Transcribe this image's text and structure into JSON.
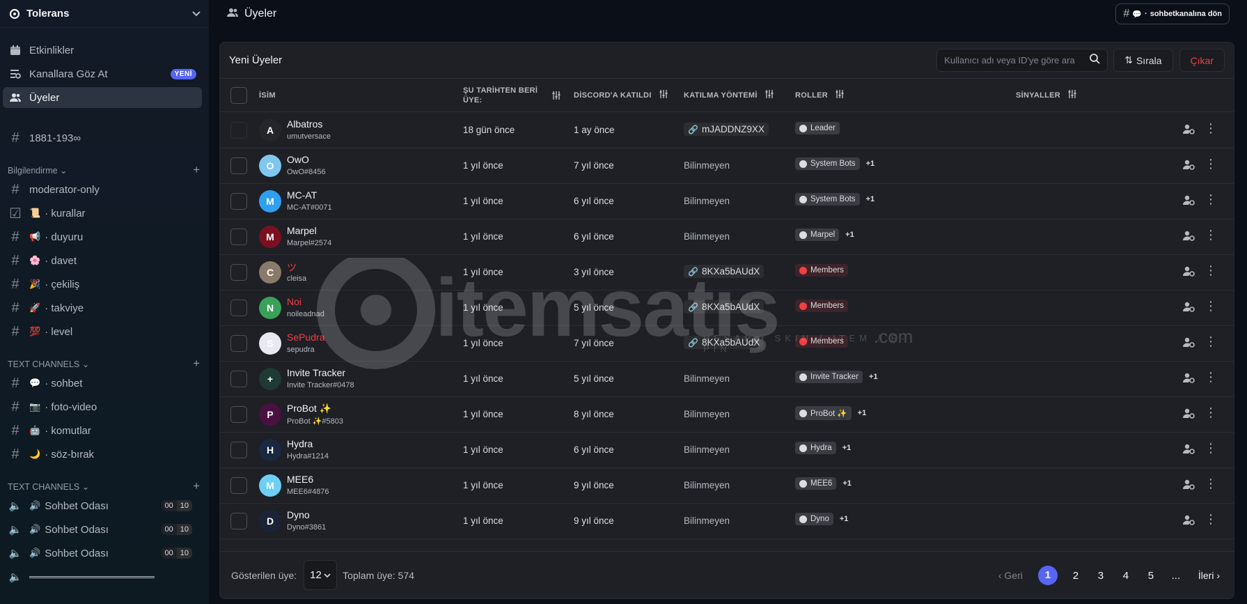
{
  "server": {
    "name": "Tolerans"
  },
  "nav": [
    {
      "label": "Etkinlikler",
      "icon": "calendar-icon"
    },
    {
      "label": "Kanallara Göz At",
      "icon": "browse-channels-icon",
      "badge": "YENİ"
    },
    {
      "label": "Üyeler",
      "icon": "members-icon",
      "active": true
    }
  ],
  "pinned_channel": {
    "label": "1881-193∞"
  },
  "categories": [
    {
      "label": "Bilgilendirme",
      "channels": [
        {
          "label": "moderator-only",
          "emoji": ""
        },
        {
          "label": "kurallar",
          "emoji": "📜"
        },
        {
          "label": "duyuru",
          "emoji": "📢"
        },
        {
          "label": "davet",
          "emoji": "🌸"
        },
        {
          "label": "çekiliş",
          "emoji": "🎉"
        },
        {
          "label": "takviye",
          "emoji": "🚀"
        },
        {
          "label": "level",
          "emoji": "💯"
        }
      ]
    },
    {
      "label": "TEXT CHANNELS",
      "channels": [
        {
          "label": "sohbet",
          "emoji": "💬"
        },
        {
          "label": "foto-video",
          "emoji": "📷"
        },
        {
          "label": "komutlar",
          "emoji": "🤖"
        },
        {
          "label": "söz-bırak",
          "emoji": "🌙"
        }
      ]
    },
    {
      "label": "TEXT CHANNELS",
      "voice": [
        {
          "label": "Sohbet Odası",
          "emoji": "🔊",
          "count_a": "00",
          "count_b": "10"
        },
        {
          "label": "Sohbet Odası",
          "emoji": "🔊",
          "count_a": "00",
          "count_b": "10"
        },
        {
          "label": "Sohbet Odası",
          "emoji": "🔊",
          "count_a": "00",
          "count_b": "10"
        }
      ]
    }
  ],
  "topbar": {
    "title": "Üyeler",
    "back_label": "sohbetkanalına dön"
  },
  "panel": {
    "title": "Yeni Üyeler",
    "search_placeholder": "Kullanıcı adı veya ID'ye göre ara",
    "sort_label": "Sırala",
    "kick_label": "Çıkar",
    "columns": {
      "name": "İSİM",
      "since_1": "ŞU TARİHTEN BERİ",
      "since_2": "ÜYE:",
      "discord": "DİSCORD'A KATILDI",
      "method": "KATILMA YÖNTEMİ",
      "roles": "ROLLER",
      "signals": "SİNYALLER"
    },
    "members": [
      {
        "name": "Albatros",
        "tag": "umutversace",
        "since": "18 gün önce",
        "discord": "1 ay önce",
        "method": "mJADDNZ9XX",
        "method_link": true,
        "role": "Leader",
        "role_extra": "",
        "avatar_color": "#23272a",
        "avatar_letter": "A",
        "red_name": false,
        "red_role": false
      },
      {
        "name": "OwO",
        "tag": "OwO#8456",
        "since": "1 yıl önce",
        "discord": "7 yıl önce",
        "method": "Bilinmeyen",
        "method_link": false,
        "role": "System Bots",
        "role_extra": "+1",
        "avatar_color": "#7ec8f0",
        "avatar_letter": "O",
        "red_name": false,
        "red_role": false
      },
      {
        "name": "MC-AT",
        "tag": "MC-AT#0071",
        "since": "1 yıl önce",
        "discord": "6 yıl önce",
        "method": "Bilinmeyen",
        "method_link": false,
        "role": "System Bots",
        "role_extra": "+1",
        "avatar_color": "#2f9ff0",
        "avatar_letter": "M",
        "red_name": false,
        "red_role": false
      },
      {
        "name": "Marpel",
        "tag": "Marpel#2574",
        "since": "1 yıl önce",
        "discord": "6 yıl önce",
        "method": "Bilinmeyen",
        "method_link": false,
        "role": "Marpel",
        "role_extra": "+1",
        "avatar_color": "#7a1020",
        "avatar_letter": "M",
        "red_name": false,
        "red_role": false
      },
      {
        "name": "ツ",
        "tag": "cleisa",
        "since": "1 yıl önce",
        "discord": "3 yıl önce",
        "method": "8KXa5bAUdX",
        "method_link": true,
        "role": "Members",
        "role_extra": "",
        "avatar_color": "#8a7a6a",
        "avatar_letter": "C",
        "red_name": true,
        "red_role": true
      },
      {
        "name": "Noi",
        "tag": "noileadnad",
        "since": "1 yıl önce",
        "discord": "5 yıl önce",
        "method": "8KXa5bAUdX",
        "method_link": true,
        "role": "Members",
        "role_extra": "",
        "avatar_color": "#3aa05a",
        "avatar_letter": "N",
        "red_name": true,
        "red_role": true
      },
      {
        "name": "SePudra",
        "tag": "sepudra",
        "since": "1 yıl önce",
        "discord": "7 yıl önce",
        "method": "8KXa5bAUdX",
        "method_link": true,
        "role": "Members",
        "role_extra": "",
        "avatar_color": "#e8e8f0",
        "avatar_letter": "S",
        "red_name": true,
        "red_role": true
      },
      {
        "name": "Invite Tracker",
        "tag": "Invite Tracker#0478",
        "since": "1 yıl önce",
        "discord": "5 yıl önce",
        "method": "Bilinmeyen",
        "method_link": false,
        "role": "Invite Tracker",
        "role_extra": "+1",
        "avatar_color": "#1e3a34",
        "avatar_letter": "+",
        "red_name": false,
        "red_role": false
      },
      {
        "name": "ProBot ✨",
        "tag": "ProBot ✨#5803",
        "since": "1 yıl önce",
        "discord": "8 yıl önce",
        "method": "Bilinmeyen",
        "method_link": false,
        "role": "ProBot ✨",
        "role_extra": "+1",
        "avatar_color": "#4a1040",
        "avatar_letter": "P",
        "red_name": false,
        "red_role": false
      },
      {
        "name": "Hydra",
        "tag": "Hydra#1214",
        "since": "1 yıl önce",
        "discord": "6 yıl önce",
        "method": "Bilinmeyen",
        "method_link": false,
        "role": "Hydra",
        "role_extra": "+1",
        "avatar_color": "#1a2840",
        "avatar_letter": "H",
        "red_name": false,
        "red_role": false
      },
      {
        "name": "MEE6",
        "tag": "MEE6#4876",
        "since": "1 yıl önce",
        "discord": "9 yıl önce",
        "method": "Bilinmeyen",
        "method_link": false,
        "role": "MEE6",
        "role_extra": "+1",
        "avatar_color": "#6ecff6",
        "avatar_letter": "M",
        "red_name": false,
        "red_role": false
      },
      {
        "name": "Dyno",
        "tag": "Dyno#3861",
        "since": "1 yıl önce",
        "discord": "9 yıl önce",
        "method": "Bilinmeyen",
        "method_link": false,
        "role": "Dyno",
        "role_extra": "+1",
        "avatar_color": "#1b2436",
        "avatar_letter": "D",
        "red_name": false,
        "red_role": false
      }
    ],
    "footer": {
      "shown_label": "Gösterilen üye:",
      "per_page": "12",
      "total_label": "Toplam üye: 574",
      "prev": "Geri",
      "pages": [
        "1",
        "2",
        "3",
        "4",
        "5",
        "..."
      ],
      "next": "İleri"
    }
  },
  "watermark": {
    "brand": "itemsatış",
    "tagline": "HESAP / SKIN / ITEM / E-PIN",
    "suffix": ".com"
  },
  "colors": {
    "accent": "#5865f2",
    "danger": "#f23f42",
    "badge": "#5865f2"
  }
}
